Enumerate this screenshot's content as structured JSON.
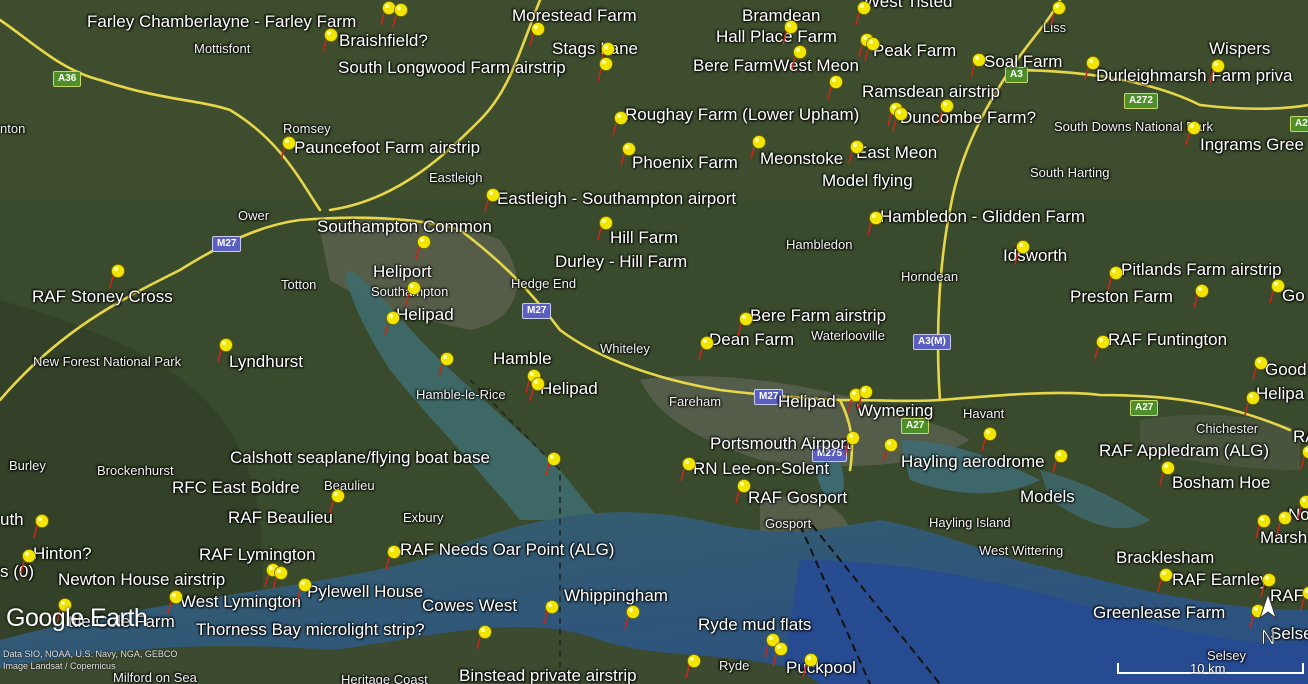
{
  "app": {
    "logo_text": "Google Earth",
    "credits": [
      "Data SIO, NOAA, U.S. Navy, NGA, GEBCO",
      "Image Landsat / Copernicus"
    ],
    "scale_label": "10 km",
    "compass_label": "N"
  },
  "colors": {
    "land": "#3b4a2e",
    "sea": "#2f5a6e",
    "deep_sea": "#2b4b8a",
    "road": "#e8d84a",
    "pin": "#f2e600"
  },
  "roads": {
    "A36": "A36",
    "M27_west": "M27",
    "M27_mid": "M27",
    "M27_east": "M27",
    "A3M": "A3(M)",
    "A27_1": "A27",
    "A27_2": "A27",
    "A3": "A3",
    "A272": "A272",
    "A2": "A2",
    "M275": "M275"
  },
  "places": {
    "mottisfont": "Mottisfont",
    "romsey": "Romsey",
    "eastleigh": "Eastleigh",
    "ower": "Ower",
    "totton": "Totton",
    "southampton": "Southampton",
    "hedge_end": "Hedge End",
    "whiteley": "Whiteley",
    "fareham": "Fareham",
    "waterlooville": "Waterlooville",
    "havant": "Havant",
    "hambledon": "Hambledon",
    "horndean": "Horndean",
    "south_harting": "South Harting",
    "south_downs": "South Downs National Park",
    "new_forest": "New Forest National Park",
    "burley": "Burley",
    "brockenhurst": "Brockenhurst",
    "beaulieu": "Beaulieu",
    "exbury": "Exbury",
    "hamble_le_rice": "Hamble-le-Rice",
    "gosport": "Gosport",
    "hayling_island": "Hayling Island",
    "west_wittering": "West Wittering",
    "chichester": "Chichester",
    "selsey": "Selsey",
    "ryde": "Ryde",
    "liss": "Liss",
    "nton": "nton",
    "uth": "uth",
    "milford": "Milford on Sea",
    "heritage_coast": "Heritage Coast"
  },
  "markers": {
    "farley": "Farley Chamberlayne - Farley Farm",
    "braishfield": "Braishfield?",
    "south_longwood": "South Longwood Farm airstrip",
    "morestead": "Morestead Farm",
    "stags_lane": "Stags Lane",
    "bramdean": "Bramdean",
    "hall_place": "Hall Place Farm",
    "peak_farm": "Peak Farm",
    "bere_farm_west_meon": "Bere FarmWest Meon",
    "west_tisted": "West Tisted",
    "soal_farm": "Soal Farm",
    "wispers": "Wispers",
    "durleighmarsh": "Durleighmarsh Farm priva",
    "ramsdean": "Ramsdean airstrip",
    "duncombe": "Duncombe Farm?",
    "ingrams": "Ingrams Gree",
    "roughay": "Roughay Farm (Lower Upham)",
    "pauncefoot": "Pauncefoot Farm airstrip",
    "phoenix": "Phoenix Farm",
    "meonstoke": "Meonstoke",
    "east_meon": "East Meon",
    "model_flying": "Model flying",
    "eastleigh_airport": "Eastleigh - Southampton airport",
    "southampton_common": "Southampton Common",
    "hambledon_glidden": "Hambledon - Glidden Farm",
    "hill_farm": "Hill Farm",
    "durley": "Durley - Hill Farm",
    "idsworth": "Idsworth",
    "pitlands": "Pitlands Farm airstrip",
    "preston": "Preston Farm",
    "go": "Go",
    "heliport": "Heliport",
    "raf_stoney_cross": "RAF Stoney Cross",
    "helipad_1": "Helipad",
    "bere_farm_airstrip": "Bere Farm airstrip",
    "dean_farm": "Dean Farm",
    "raf_funtington": "RAF Funtington",
    "lyndhurst": "Lyndhurst",
    "hamble": "Hamble",
    "helipad_2": "Helipad",
    "good": "Good",
    "helipa": "Helipa",
    "helipad_3": "Helipad",
    "wymering": "Wymering",
    "portsmouth_airport": "Portsmouth Airport",
    "raf_appledram": "RAF Appledram (ALG)",
    "raf_edge": "RA",
    "calshott": "Calshott seaplane/flying boat base",
    "rn_lee": "RN Lee-on-Solent",
    "hayling_aerodrome": "Hayling aerodrome",
    "bosham_hoe": "Bosham Hoe",
    "rfc_east_boldre": "RFC East Boldre",
    "models": "Models",
    "raf_gosport": "RAF Gosport",
    "raf_beaulieu": "RAF Beaulieu",
    "no": "No",
    "marsh": "Marsh",
    "hinton": "Hinton?",
    "s0": "s (0)",
    "raf_lymington": "RAF Lymington",
    "raf_needs_oar": "RAF Needs Oar Point (ALG)",
    "bracklesham": "Bracklesham",
    "newton_house": "Newton House airstrip",
    "raf_earnley": "RAF Earnley",
    "pylewell": "Pylewell House",
    "west_lymington": "West Lymington",
    "raf_edge2": "RAF",
    "cowes_west": "Cowes West",
    "whippingham": "Whippingham",
    "greenlease": "Greenlease Farm",
    "ttle_cole": "ttle Cole Farm",
    "thorness": "Thorness Bay microlight strip?",
    "ryde_mud": "Ryde mud flats",
    "selse": "Selse",
    "binstead": "Binstead private airstrip",
    "puckpool": "Puckpool"
  }
}
